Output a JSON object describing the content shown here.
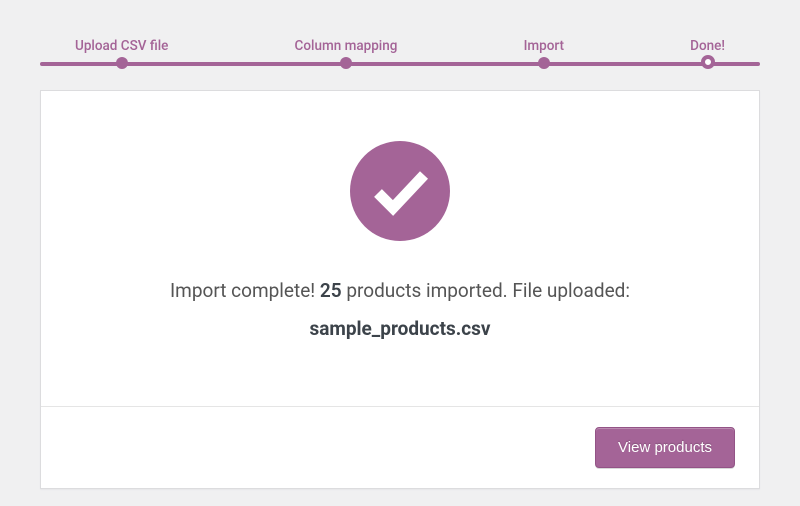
{
  "steps": {
    "labels": [
      "Upload CSV file",
      "Column mapping",
      "Import",
      "Done!"
    ],
    "current_index": 3,
    "accent_color": "#a46497"
  },
  "result": {
    "prefix": "Import complete! ",
    "count": "25",
    "after_count": " products imported. File uploaded:",
    "filename": "sample_products.csv"
  },
  "actions": {
    "view_products_label": "View products"
  }
}
